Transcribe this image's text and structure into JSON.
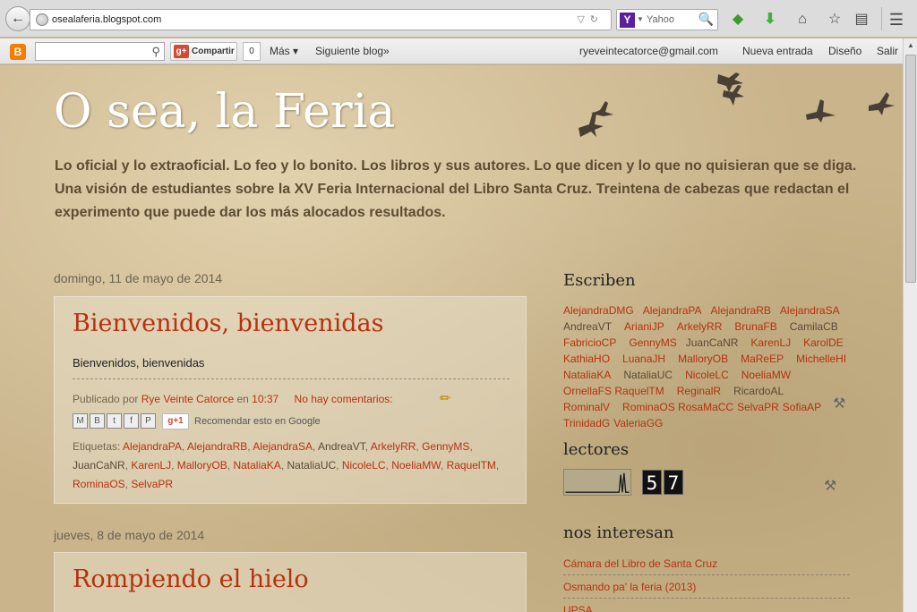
{
  "browser": {
    "url": "osealaferia.blogspot.com",
    "search_placeholder": "Yahoo",
    "search_engine_logo": "Y",
    "icons": {
      "back": "back-arrow-icon",
      "search": "magnifier-icon",
      "home": "home-icon",
      "bookmark": "star-icon",
      "download": "download-arrow-icon",
      "menu": "hamburger-icon"
    }
  },
  "navbar": {
    "blogger_logo": "B",
    "share_label": "Compartir",
    "share_count": "0",
    "gplus_logo": "g+",
    "more_label": "Más ▾",
    "next_blog_label": "Siguiente blog»",
    "email": "ryeveintecatorce@gmail.com",
    "new_post_label": "Nueva entrada",
    "design_label": "Diseño",
    "logout_label": "Salir"
  },
  "blog": {
    "title": "O sea, la Feria",
    "description": "Lo oficial y lo extraoficial. Lo feo y lo bonito. Los libros y sus autores. Lo que dicen y lo que no quisieran que se diga. Una visión de estudiantes sobre la XV Feria Internacional del Libro Santa Cruz. Treintena de cabezas que redactan el experimento que puede dar los más alocados resultados."
  },
  "posts": [
    {
      "date": "domingo, 11 de mayo de 2014",
      "title": "Bienvenidos, bienvenidas",
      "body": "Bienvenidos, bienvenidas",
      "published_by_label": "Publicado por",
      "author": "Rye Veinte Catorce",
      "at_label": "en",
      "time": "10:37",
      "comments": "No hay comentarios:",
      "gplus_label": "g+1",
      "recommend_label": "Recomendar esto en Google",
      "labels_title": "Etiquetas:",
      "labels": [
        "AlejandraPA",
        "AlejandraRB",
        "AlejandraSA",
        "AndreaVT",
        "ArkelyRR",
        "GennyMS",
        "JuanCaNR",
        "KarenLJ",
        "MalloryOB",
        "NataliaKA",
        "NataliaUC",
        "NicoleLC",
        "NoeliaMW",
        "RaquelTM",
        "RominaOS",
        "SelvaPR"
      ]
    },
    {
      "date": "jueves, 8 de mayo de 2014",
      "title": "Rompiendo el hielo"
    }
  ],
  "sidebar": {
    "writers_title": "Escriben",
    "writers": [
      "AlejandraDMG",
      "AlejandraPA",
      "AlejandraRB",
      "AlejandraSA",
      "AndreaVT",
      "ArianiJP",
      "ArkelyRR",
      "BrunaFB",
      "CamilaCB",
      "FabricioCP",
      "GennyMS",
      "JuanCaNR",
      "KarenLJ",
      "KarolDE",
      "KathiaHO",
      "LuanaJH",
      "MalloryOB",
      "MaReEP",
      "MichelleHI",
      "NataliaKA",
      "NataliaUC",
      "NicoleLC",
      "NoeliaMW",
      "OrnellaFS",
      "RaquelTM",
      "ReginalR",
      "RicardoAL",
      "RominalV",
      "RominaOS",
      "RosaMaCC",
      "SelvaPR",
      "SofiaAP",
      "TrinidadG",
      "ValeriaGG"
    ],
    "readers_title": "lectores",
    "counter": [
      "5",
      "7"
    ],
    "interests_title": "nos interesan",
    "interests": [
      "Cámara del Libro de Santa Cruz",
      "Osmando pa' la feria (2013)",
      "UPSA"
    ]
  }
}
